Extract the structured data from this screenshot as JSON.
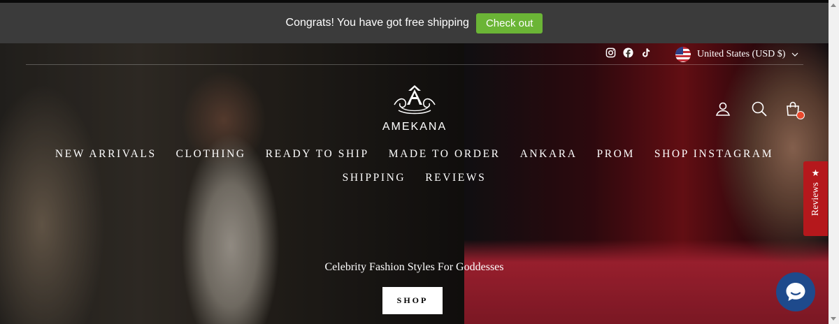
{
  "announcement": {
    "text": "Congrats! You have got free shipping",
    "button_label": "Check out",
    "button_color": "#6bb536"
  },
  "utility": {
    "social_icons": [
      "instagram-icon",
      "facebook-icon",
      "tiktok-icon"
    ],
    "currency_label": "United States (USD $)"
  },
  "brand": {
    "name": "AMEKANA"
  },
  "nav": {
    "row1": [
      "NEW ARRIVALS",
      "CLOTHING",
      "READY TO SHIP",
      "MADE TO ORDER",
      "ANKARA",
      "PROM",
      "SHOP INSTAGRAM"
    ],
    "row2": [
      "SHIPPING",
      "REVIEWS"
    ]
  },
  "header_icons": [
    "account-icon",
    "search-icon",
    "cart-icon"
  ],
  "hero": {
    "tagline": "Celebrity Fashion Styles For Goddesses",
    "cta_label": "SHOP"
  },
  "reviews_tab": {
    "label": "Reviews",
    "color": "#b5181c"
  },
  "chat": {
    "icon": "chat-bubble-icon",
    "color": "#1e4a8c"
  }
}
